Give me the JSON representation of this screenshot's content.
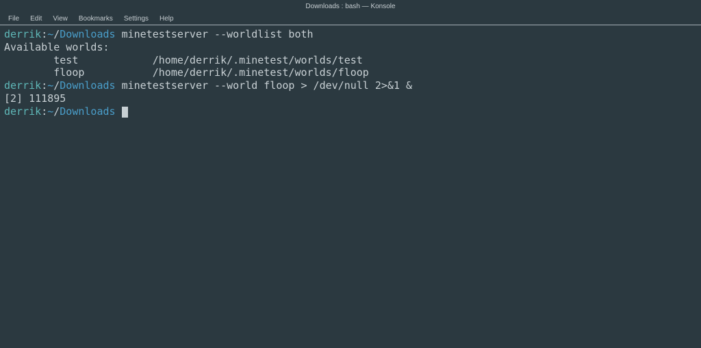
{
  "window": {
    "title": "Downloads : bash — Konsole"
  },
  "menu": {
    "items": [
      "File",
      "Edit",
      "View",
      "Bookmarks",
      "Settings",
      "Help"
    ]
  },
  "prompt": {
    "user": "derrik",
    "sep1": ":",
    "tilde": "~",
    "pathsep": "/",
    "path": "Downloads"
  },
  "lines": {
    "cmd1": "minetestserver --worldlist both",
    "out1": "Available worlds:",
    "out2": "        test            /home/derrik/.minetest/worlds/test",
    "out3": "        floop           /home/derrik/.minetest/worlds/floop",
    "cmd2": "minetestserver --world floop > /dev/null 2>&1 &",
    "out4": "[2] 111895"
  }
}
